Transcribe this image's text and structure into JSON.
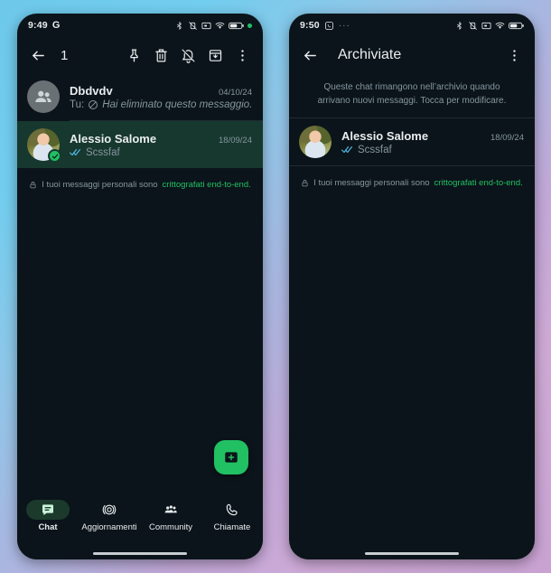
{
  "left_phone": {
    "statusbar": {
      "time": "9:49",
      "left_glyph": "G",
      "icons": [
        "bluetooth-icon",
        "vibrate-off-icon",
        "cast-icon",
        "wifi-icon",
        "battery-icon",
        "green-dot-icon"
      ]
    },
    "toolbar": {
      "back_label": "back-arrow",
      "selection_count": "1",
      "actions": [
        "pin-icon",
        "delete-icon",
        "mute-icon",
        "archive-icon",
        "overflow-menu-icon"
      ]
    },
    "chats": [
      {
        "name": "Dbdvdv",
        "date": "04/10/24",
        "prefix": "Tu:",
        "preview": "Hai eliminato questo messaggio.",
        "preview_icon": "blocked-icon",
        "avatar_type": "group",
        "selected": false
      },
      {
        "name": "Alessio Salome",
        "date": "18/09/24",
        "prefix": "",
        "preview": "Scssfaf",
        "preview_icon": "double-check-icon",
        "avatar_type": "photo",
        "selected": true
      }
    ],
    "encryption": {
      "icon": "lock-icon",
      "text": "I tuoi messaggi personali sono ",
      "link": "crittografati end-to-end."
    },
    "fab": {
      "icon": "new-chat-icon"
    },
    "bottom_nav": [
      {
        "label": "Chat",
        "icon": "chat-icon",
        "active": true
      },
      {
        "label": "Aggiornamenti",
        "icon": "updates-icon",
        "active": false
      },
      {
        "label": "Community",
        "icon": "community-icon",
        "active": false
      },
      {
        "label": "Chiamate",
        "icon": "calls-icon",
        "active": false
      }
    ]
  },
  "right_phone": {
    "statusbar": {
      "time": "9:50",
      "app_icon": "whatsapp-icon",
      "overflow_dots": "···",
      "icons": [
        "bluetooth-icon",
        "vibrate-off-icon",
        "cast-icon",
        "wifi-icon",
        "battery-icon"
      ]
    },
    "toolbar": {
      "back_label": "back-arrow",
      "title": "Archiviate",
      "actions": [
        "overflow-menu-icon"
      ]
    },
    "archive_note": "Queste chat rimangono nell’archivio quando arrivano nuovi messaggi. Tocca per modificare.",
    "chats": [
      {
        "name": "Alessio Salome",
        "date": "18/09/24",
        "prefix": "",
        "preview": "Scssfaf",
        "preview_icon": "double-check-icon",
        "avatar_type": "photo",
        "selected": false
      }
    ],
    "encryption": {
      "icon": "lock-icon",
      "text": "I tuoi messaggi personali sono ",
      "link": "crittografati end-to-end."
    }
  },
  "colors": {
    "accent_green": "#21c063",
    "selected_row": "#17382e",
    "app_background": "#0b141a",
    "text_primary": "#e9edef",
    "text_secondary": "#8696a0",
    "tick_blue": "#53bdeb"
  }
}
